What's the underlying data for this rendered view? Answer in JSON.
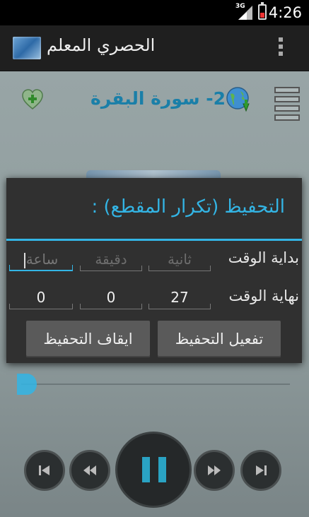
{
  "status_bar": {
    "time": "4:26",
    "network": "3G"
  },
  "action_bar": {
    "title": "الحصري المعلم"
  },
  "player": {
    "surah_title": "2- سورة البقرة",
    "progress": 0.0
  },
  "dialog": {
    "title": "التحفيظ (تكرار المقطع) :",
    "start_label": "بداية الوقت",
    "end_label": "نهاية الوقت",
    "start_fields": {
      "hour_placeholder": "ساعة",
      "minute_placeholder": "دقيقة",
      "second_placeholder": "ثانية"
    },
    "end_fields": {
      "hour": "0",
      "minute": "0",
      "second": "27"
    },
    "activate_button": "تفعيل التحفيظ",
    "stop_button": "ايقاف التحفيظ"
  },
  "colors": {
    "accent": "#33b5e5",
    "title_blue": "#1a7fa8",
    "dialog_bg": "#303030"
  }
}
